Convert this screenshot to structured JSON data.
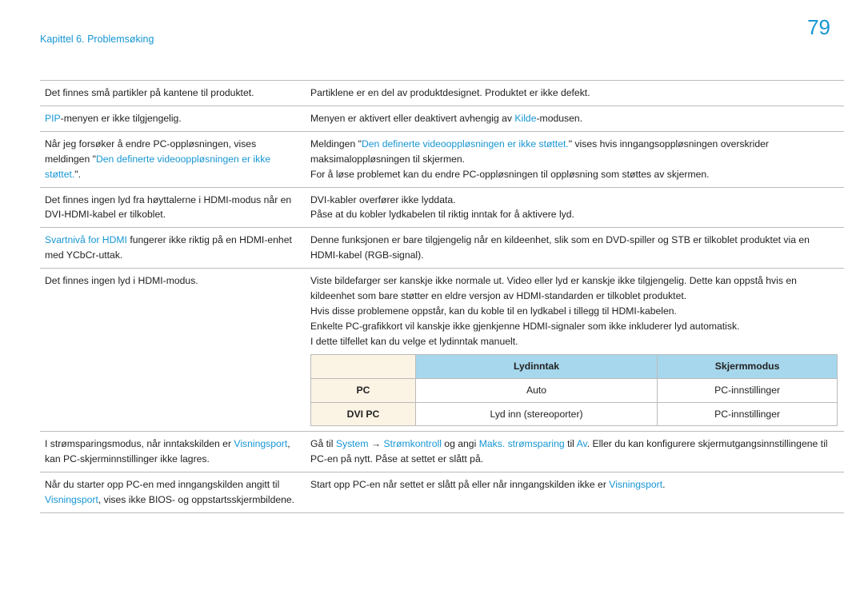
{
  "page_number": "79",
  "header": "Kapittel 6. Problemsøking",
  "rows": [
    {
      "l": [
        {
          "t": "Det finnes små partikler på kantene til produktet."
        }
      ],
      "r": [
        {
          "t": "Partiklene er en del av produktdesignet. Produktet er ikke defekt."
        }
      ]
    },
    {
      "l": [
        {
          "t": "PIP",
          "c": "blue"
        },
        {
          "t": "-menyen er ikke tilgjengelig."
        }
      ],
      "r": [
        {
          "t": "Menyen er aktivert eller deaktivert avhengig av "
        },
        {
          "t": "Kilde",
          "c": "blue"
        },
        {
          "t": "-modusen."
        }
      ]
    },
    {
      "l": [
        {
          "t": "Når jeg forsøker å endre PC-oppløsningen, vises meldingen \""
        },
        {
          "t": "Den definerte videooppløsningen er ikke støttet.",
          "c": "blue"
        },
        {
          "t": "\"."
        }
      ],
      "r": [
        {
          "t": "Meldingen \""
        },
        {
          "t": "Den definerte videooppløsningen er ikke støttet.",
          "c": "blue"
        },
        {
          "t": "\" vises hvis inngangsoppløsningen overskrider maksimaloppløsningen til skjermen."
        },
        {
          "br": true
        },
        {
          "t": "For å løse problemet kan du endre PC-oppløsningen til oppløsning som støttes av skjermen."
        }
      ]
    },
    {
      "l": [
        {
          "t": "Det finnes ingen lyd fra høyttalerne i HDMI-modus når en DVI-HDMI-kabel er tilkoblet."
        }
      ],
      "r": [
        {
          "t": "DVI-kabler overfører ikke lyddata."
        },
        {
          "br": true
        },
        {
          "t": "Påse at du kobler lydkabelen til riktig inntak for å aktivere lyd."
        }
      ]
    },
    {
      "l": [
        {
          "t": "Svartnivå for HDMI",
          "c": "blue"
        },
        {
          "t": " fungerer ikke riktig på en HDMI-enhet med YCbCr-uttak."
        }
      ],
      "r": [
        {
          "t": "Denne funksjonen er bare tilgjengelig når en kildeenhet, slik som en DVD-spiller og STB er tilkoblet produktet via en HDMI-kabel (RGB-signal)."
        }
      ]
    },
    {
      "l": [
        {
          "t": "Det finnes ingen lyd i HDMI-modus."
        }
      ],
      "r": [
        {
          "t": "Viste bildefarger ser kanskje ikke normale ut. Video eller lyd er kanskje ikke tilgjengelig. Dette kan oppstå hvis en kildeenhet som bare støtter en eldre versjon av HDMI-standarden er tilkoblet produktet."
        },
        {
          "br": true
        },
        {
          "t": "Hvis disse problemene oppstår, kan du koble til en lydkabel i tillegg til HDMI-kabelen."
        },
        {
          "br": true
        },
        {
          "t": "Enkelte PC-grafikkort vil kanskje ikke gjenkjenne HDMI-signaler som ikke inkluderer lyd automatisk."
        },
        {
          "br": true
        },
        {
          "t": "I dette tilfellet kan du velge et lydinntak manuelt."
        }
      ],
      "inner": {
        "headers": [
          "",
          "Lydinntak",
          "Skjermmodus"
        ],
        "rows": [
          [
            "PC",
            "Auto",
            "PC-innstillinger"
          ],
          [
            "DVI PC",
            "Lyd inn (stereoporter)",
            "PC-innstillinger"
          ]
        ]
      }
    },
    {
      "l": [
        {
          "t": "I strømsparingsmodus, når inntakskilden er "
        },
        {
          "t": "Visningsport",
          "c": "blue"
        },
        {
          "t": ", kan PC-skjerminnstillinger ikke lagres."
        }
      ],
      "r": [
        {
          "t": "Gå til "
        },
        {
          "t": "System",
          "c": "blue"
        },
        {
          "t": " → "
        },
        {
          "t": "Strømkontroll",
          "c": "blue"
        },
        {
          "t": " og angi "
        },
        {
          "t": "Maks. strømsparing",
          "c": "blue"
        },
        {
          "t": " til "
        },
        {
          "t": "Av",
          "c": "blue"
        },
        {
          "t": ". Eller du kan konfigurere skjermutgangsinnstillingene til PC-en på nytt. Påse at settet er slått på."
        }
      ]
    },
    {
      "l": [
        {
          "t": "Når du starter opp PC-en med inngangskilden angitt til "
        },
        {
          "t": "Visningsport",
          "c": "blue"
        },
        {
          "t": ", vises ikke BIOS- og oppstartsskjermbildene."
        }
      ],
      "r": [
        {
          "t": "Start opp PC-en når settet er slått på eller når inngangskilden ikke er "
        },
        {
          "t": "Visningsport",
          "c": "blue"
        },
        {
          "t": "."
        }
      ]
    }
  ]
}
